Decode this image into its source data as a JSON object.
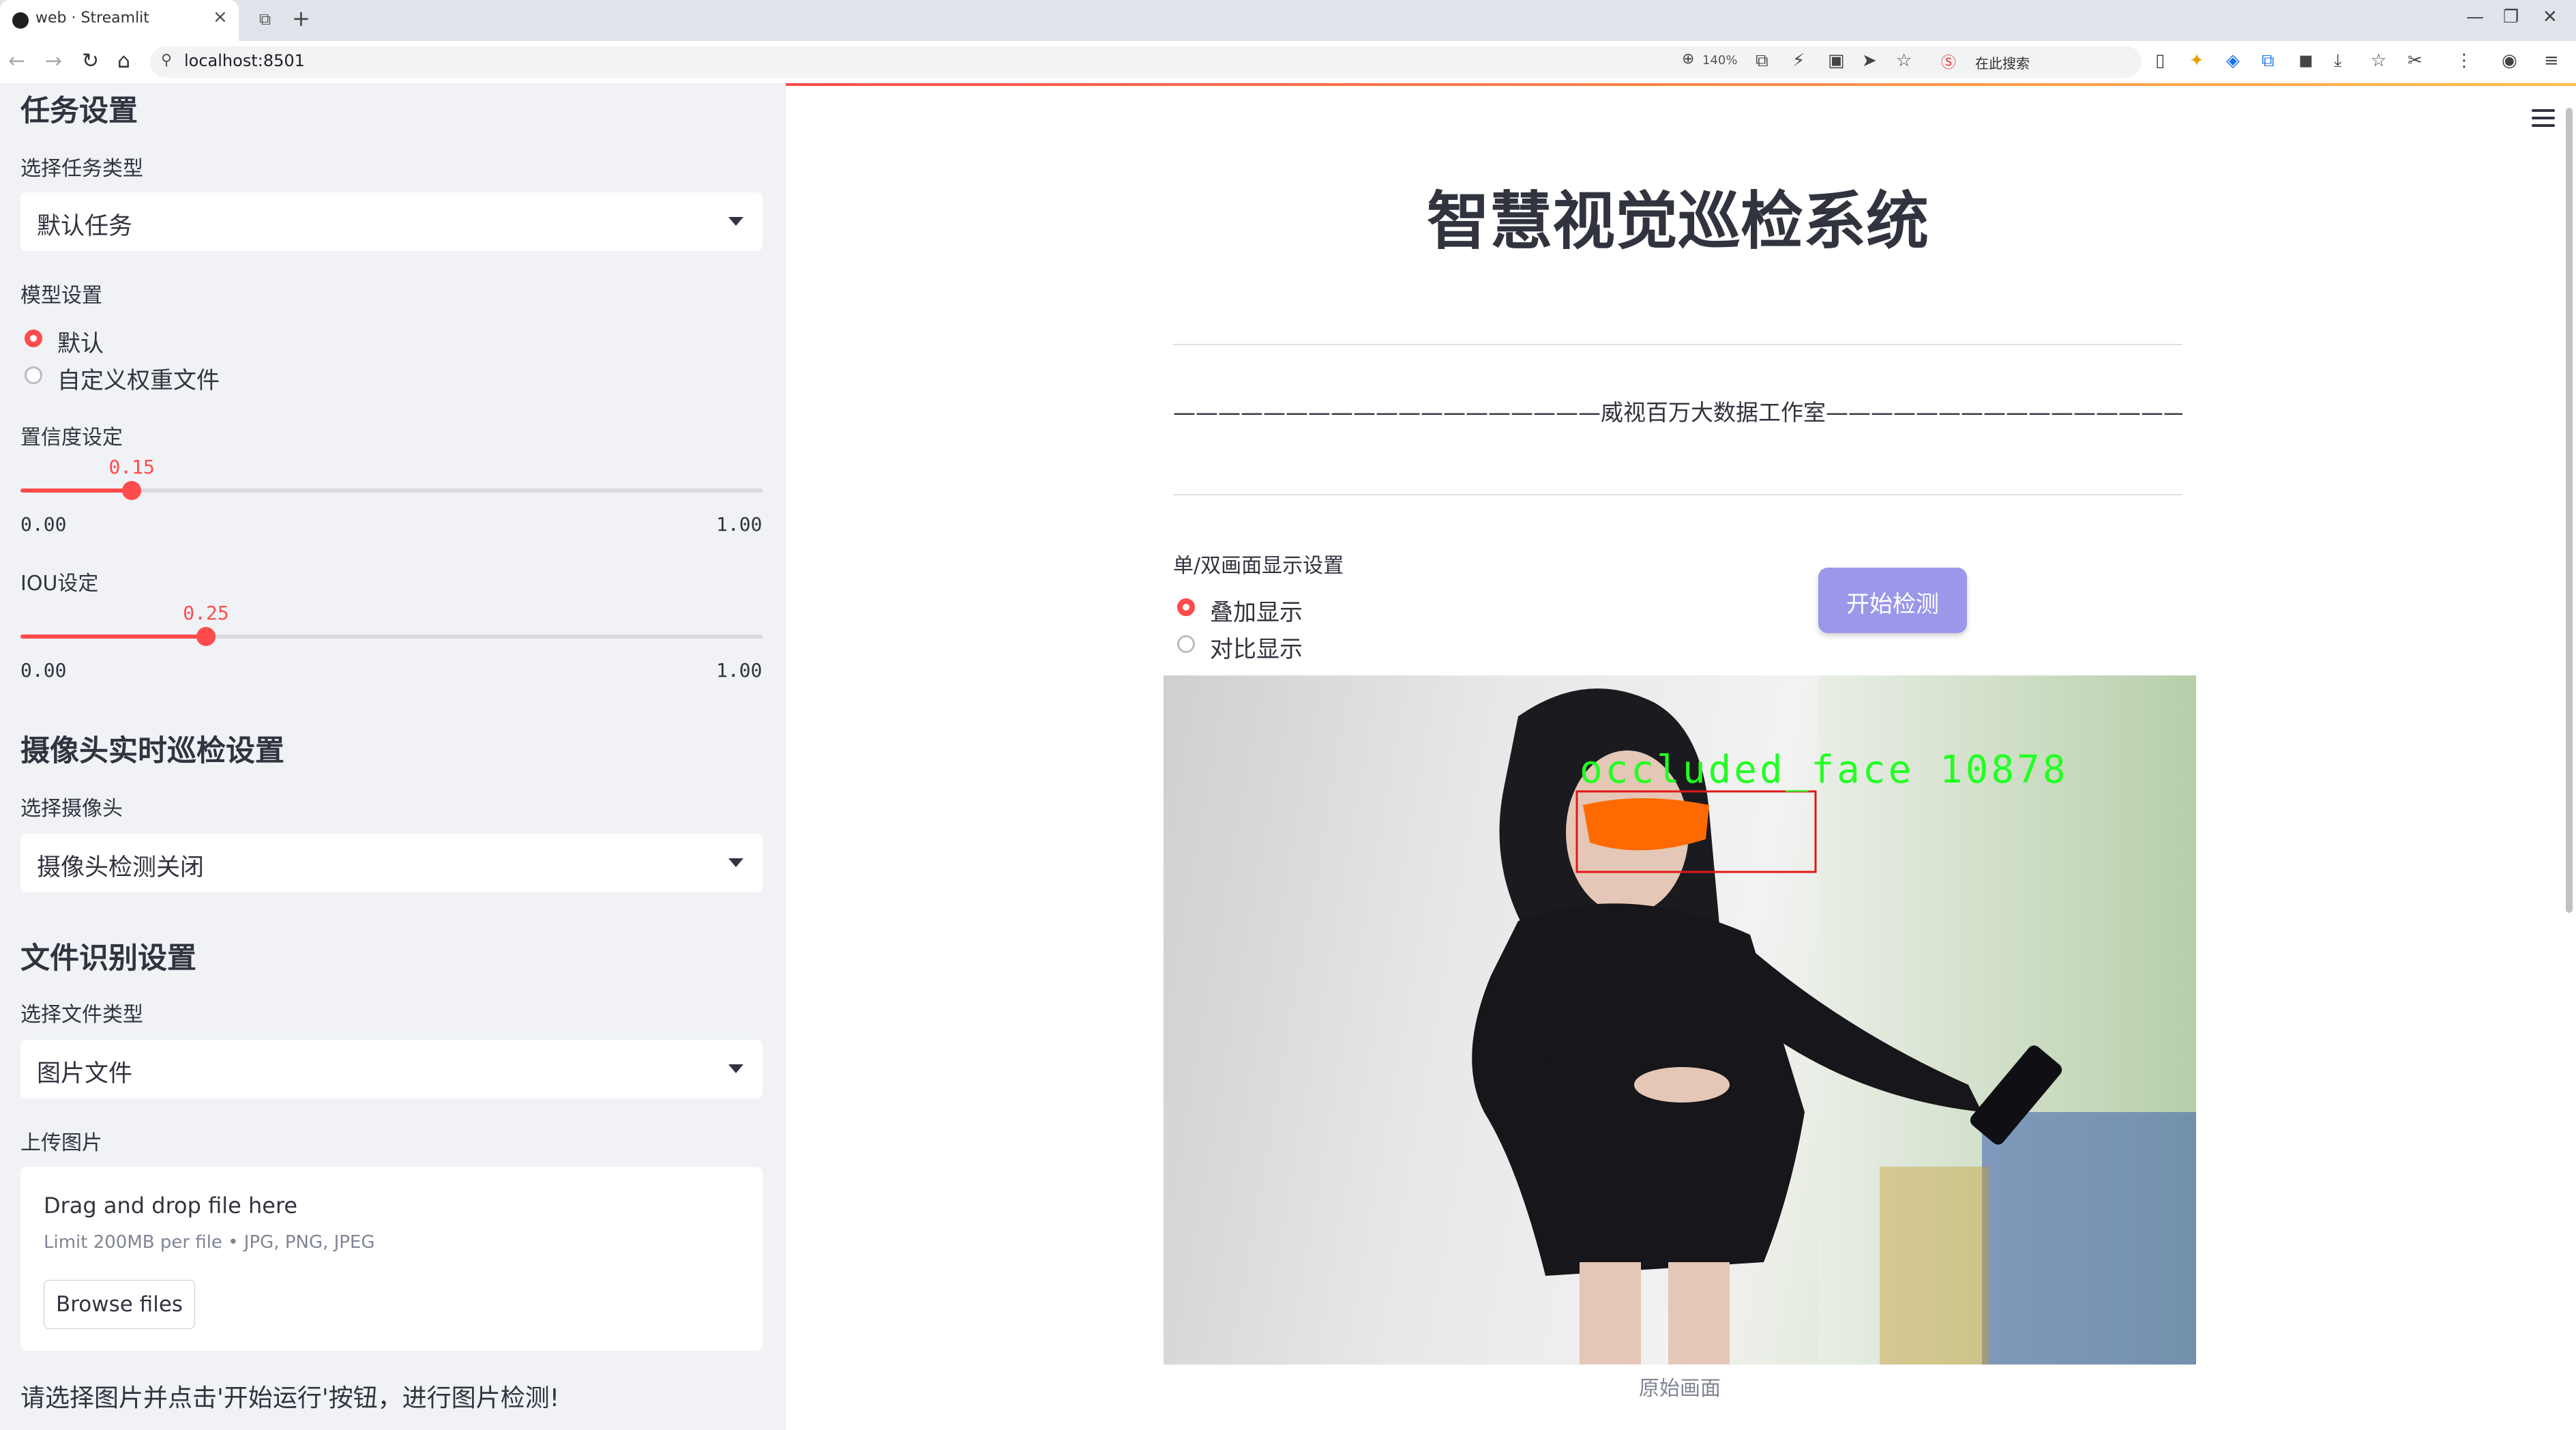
{
  "browser": {
    "tab_title": "web · Streamlit",
    "url": "localhost:8501",
    "zoom": "140%",
    "search_label": "在此搜索"
  },
  "sidebar": {
    "task_header": "任务设置",
    "task_type_label": "选择任务类型",
    "task_type_value": "默认任务",
    "model_label": "模型设置",
    "model_options": [
      "默认",
      "自定义权重文件"
    ],
    "model_selected": 0,
    "conf_label": "置信度设定",
    "conf": {
      "value": "0.15",
      "fraction": 0.15,
      "min": "0.00",
      "max": "1.00"
    },
    "iou_label": "IOU设定",
    "iou": {
      "value": "0.25",
      "fraction": 0.25,
      "min": "0.00",
      "max": "1.00"
    },
    "camera_header": "摄像头实时巡检设置",
    "camera_label": "选择摄像头",
    "camera_value": "摄像头检测关闭",
    "file_header": "文件识别设置",
    "file_type_label": "选择文件类型",
    "file_type_value": "图片文件",
    "upload_label": "上传图片",
    "dropzone_title": "Drag and drop file here",
    "dropzone_limit": "Limit 200MB per file • JPG, PNG, JPEG",
    "browse_label": "Browse files",
    "hint": "请选择图片并点击'开始运行'按钮，进行图片检测!"
  },
  "main": {
    "title": "智慧视觉巡检系统",
    "studio": "———————————————————威视百万大数据工作室————————————————————",
    "display_label": "单/双画面显示设置",
    "display_options": [
      "叠加显示",
      "对比显示"
    ],
    "display_selected": 0,
    "start_button": "开始检测",
    "detection_label": "occluded_face 10878",
    "image_caption": "原始画面"
  },
  "colors": {
    "accent": "#ff4b4b",
    "button": "#9b98ea",
    "detection_text": "#22ff22",
    "detection_box": "#e01818",
    "sidebar_bg": "#f0f2f6"
  }
}
